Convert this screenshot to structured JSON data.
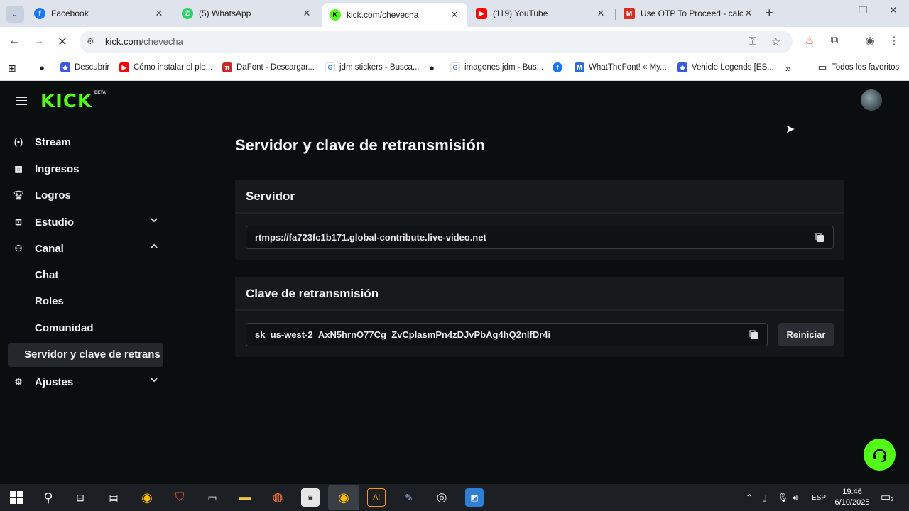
{
  "browser": {
    "tabs": [
      {
        "title": "Facebook",
        "favicon": "facebook-icon",
        "color": "#1877f2"
      },
      {
        "title": "(5) WhatsApp",
        "favicon": "whatsapp-icon",
        "color": "#25d366"
      },
      {
        "title": "kick.com/chevecha",
        "favicon": "kick-icon",
        "color": "#53fc18",
        "active": true
      },
      {
        "title": "(119) YouTube",
        "favicon": "youtube-icon",
        "color": "#ff0000"
      },
      {
        "title": "Use OTP To Proceed - calco",
        "favicon": "gmail-icon",
        "color": "#d93025"
      }
    ],
    "url_domain": "kick.com",
    "url_path": "/chevecha",
    "bookmarks": [
      {
        "label": "Descubrir",
        "icon": "discover-icon"
      },
      {
        "label": "Cómo instalar el plo...",
        "icon": "youtube-icon"
      },
      {
        "label": "DaFont - Descargar...",
        "icon": "dafont-icon"
      },
      {
        "label": "jdm stickers - Busca...",
        "icon": "google-icon"
      },
      {
        "label": "imagenes jdm - Bus...",
        "icon": "google-icon"
      },
      {
        "label": "WhatTheFont! « My...",
        "icon": "whatthefont-icon"
      },
      {
        "label": "Vehicle Legends [ES...",
        "icon": "vehicle-icon"
      },
      {
        "label": "Todos los favoritos",
        "icon": "folder-icon"
      }
    ]
  },
  "kick": {
    "brand_color": "#53fc18",
    "logo_text": "KICK",
    "beta_label": "BETA",
    "nav": {
      "stream": "Stream",
      "ingresos": "Ingresos",
      "logros": "Logros",
      "estudio": "Estudio",
      "canal": "Canal",
      "chat": "Chat",
      "roles": "Roles",
      "comunidad": "Comunidad",
      "servidor": "Servidor y clave de retrans",
      "ajustes": "Ajustes"
    },
    "page_title": "Servidor y clave de retransmisión",
    "server_section": {
      "heading": "Servidor",
      "value": "rtmps://fa723fc1b171.global-contribute.live-video.net"
    },
    "key_section": {
      "heading": "Clave de retransmisión",
      "value": "sk_us-west-2_AxN5hrnO77Cg_ZvCplasmPn4zDJvPbAg4hQ2nlfDr4i",
      "reset_label": "Reiniciar"
    }
  },
  "taskbar": {
    "language": "ESP",
    "time": "19:46",
    "date": "6/10/2025",
    "notifications": "2"
  }
}
